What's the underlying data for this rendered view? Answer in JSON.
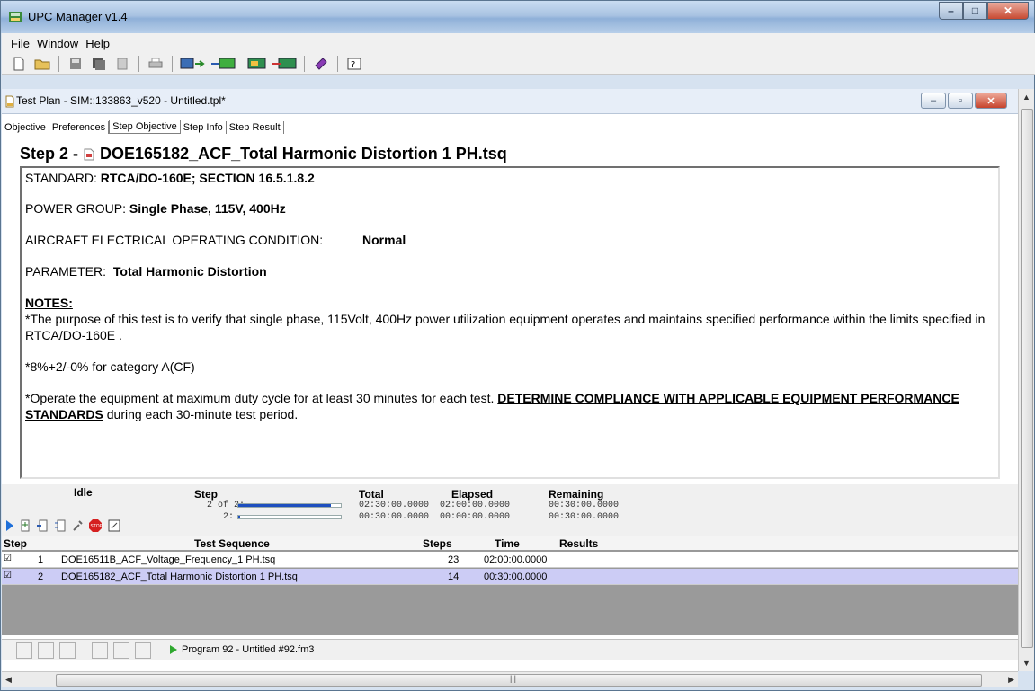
{
  "app": {
    "title": "UPC Manager v1.4"
  },
  "menu": [
    "File",
    "Window",
    "Help"
  ],
  "child": {
    "title": "Test Plan - SIM::133863_v520 - Untitled.tpl*",
    "tabs": [
      "Objective",
      "Preferences",
      "Step Objective",
      "Step Info",
      "Step Result"
    ],
    "active_tab": "Step Objective"
  },
  "step": {
    "prefix": "Step 2 -",
    "file": "DOE165182_ACF_Total Harmonic Distortion 1 PH.tsq"
  },
  "content": {
    "standard_label": "STANDARD:",
    "standard_value": "RTCA/DO-160E; SECTION 16.5.1.8.2",
    "power_label": "POWER GROUP:",
    "power_value": "Single Phase,  115V, 400Hz",
    "aircraft_label": "AIRCRAFT ELECTRICAL OPERATING CONDITION:",
    "aircraft_value": "Normal",
    "param_label": "PARAMETER:",
    "param_value": "Total Harmonic Distortion",
    "notes_head": "NOTES:",
    "note1": "*The purpose of this test is to verify that single phase, 115Volt, 400Hz power utilization equipment operates and maintains specified performance within the limits specified in RTCA/DO-160E .",
    "note2": "*8%+2/-0% for category A(CF)",
    "note3_pre": "*Operate the equipment at maximum duty cycle for at least 30 minutes for each test.",
    "note3_bold": "DETERMINE COMPLIANCE WITH APPLICABLE EQUIPMENT PERFORMANCE STANDARDS",
    "note3_post": "during each 30-minute test period."
  },
  "status": {
    "state": "Idle",
    "step_label": "Step",
    "step_line1": "2 of 2:",
    "step_line2": "2:",
    "total_label": "Total",
    "total_1": "02:30:00.0000",
    "total_2": "00:30:00.0000",
    "elapsed_label": "Elapsed",
    "elapsed_1": "02:00:00.0000",
    "elapsed_2": "00:00:00.0000",
    "remaining_label": "Remaining",
    "remaining_1": "00:30:00.0000",
    "remaining_2": "00:30:00.0000",
    "progress_1": 0.9,
    "progress_2": 0.02
  },
  "table": {
    "headers": [
      "Step",
      "Test Sequence",
      "Steps",
      "Time",
      "Results"
    ],
    "rows": [
      {
        "num": "1",
        "name": "DOE16511B_ACF_Voltage_Frequency_1 PH.tsq",
        "steps": "23",
        "time": "02:00:00.0000",
        "result": ""
      },
      {
        "num": "2",
        "name": "DOE165182_ACF_Total Harmonic Distortion 1 PH.tsq",
        "steps": "14",
        "time": "00:30:00.0000",
        "result": ""
      }
    ]
  },
  "program": "Program 92 - Untitled #92.fm3",
  "colors": {
    "accent": "#1e4fbf",
    "selected_row": "#ccccf5"
  }
}
